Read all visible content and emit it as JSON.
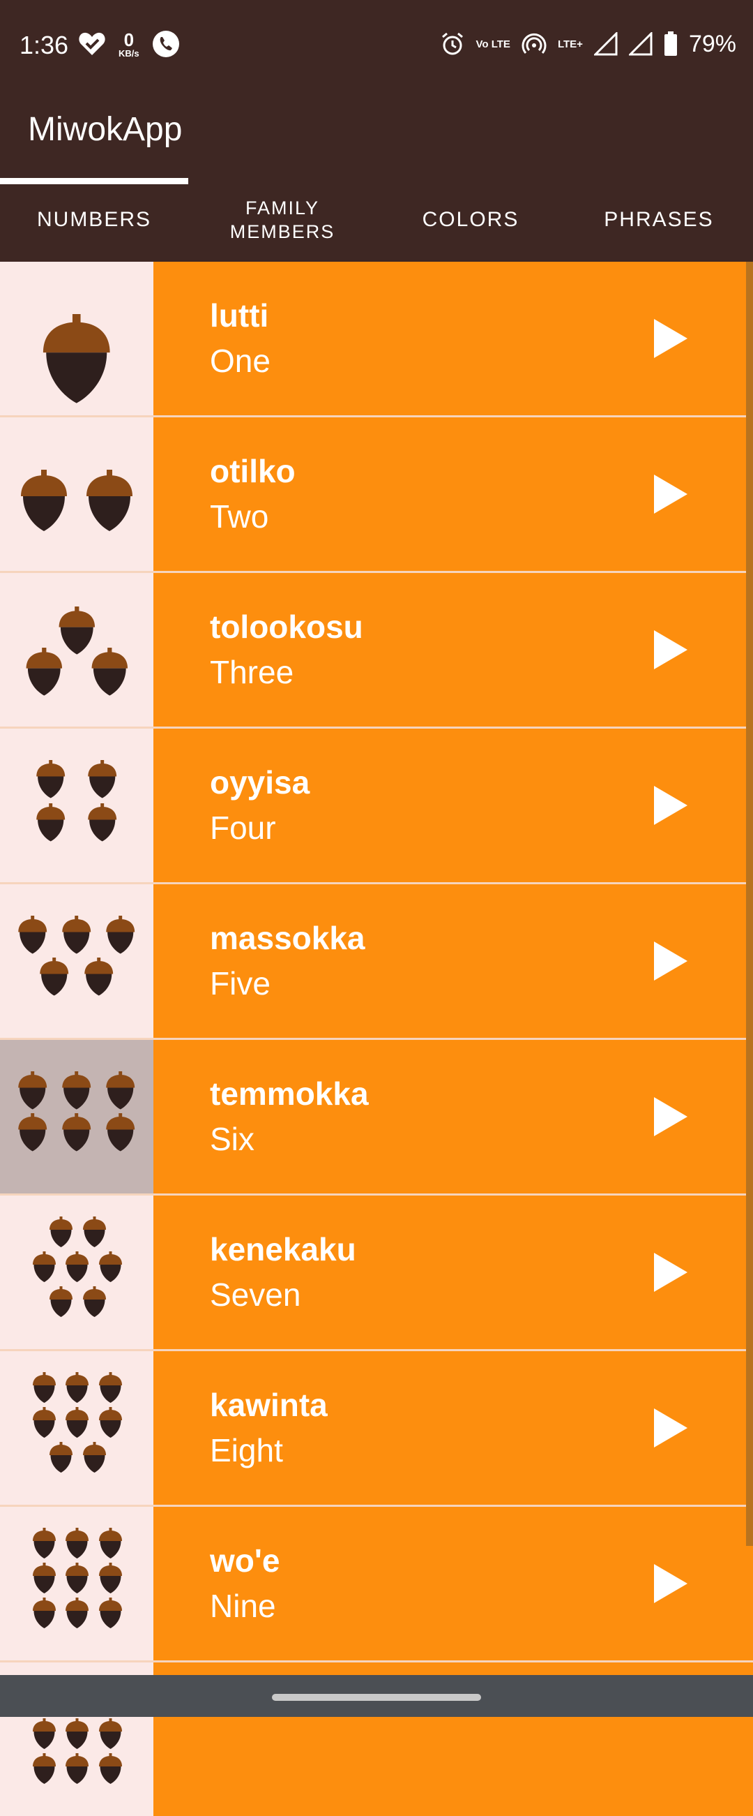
{
  "status_bar": {
    "time": "1:36",
    "kb_value": "0",
    "kb_unit": "KB/s",
    "volte": "Vo LTE",
    "lte_plus": "LTE+",
    "battery": "79%"
  },
  "app": {
    "title": "MiwokApp"
  },
  "tabs": [
    {
      "label": "NUMBERS",
      "selected": true
    },
    {
      "label": "FAMILY MEMBERS",
      "selected": false
    },
    {
      "label": "COLORS",
      "selected": false
    },
    {
      "label": "PHRASES",
      "selected": false
    }
  ],
  "colors": {
    "bar": "#3e2723",
    "row": "#fd8e0e",
    "thumb_bg": "#fbe9e7",
    "acorn_cap": "#8b4a16",
    "acorn_body": "#2e1f1d"
  },
  "words": [
    {
      "miwok": "lutti",
      "english": "One",
      "acorns": 1
    },
    {
      "miwok": "otilko",
      "english": "Two",
      "acorns": 2
    },
    {
      "miwok": "tolookosu",
      "english": "Three",
      "acorns": 3
    },
    {
      "miwok": "oyyisa",
      "english": "Four",
      "acorns": 4
    },
    {
      "miwok": "massokka",
      "english": "Five",
      "acorns": 5
    },
    {
      "miwok": "temmokka",
      "english": "Six",
      "acorns": 6,
      "pressed": true
    },
    {
      "miwok": "kenekaku",
      "english": "Seven",
      "acorns": 7
    },
    {
      "miwok": "kawinta",
      "english": "Eight",
      "acorns": 8
    },
    {
      "miwok": "wo'e",
      "english": "Nine",
      "acorns": 9
    }
  ]
}
